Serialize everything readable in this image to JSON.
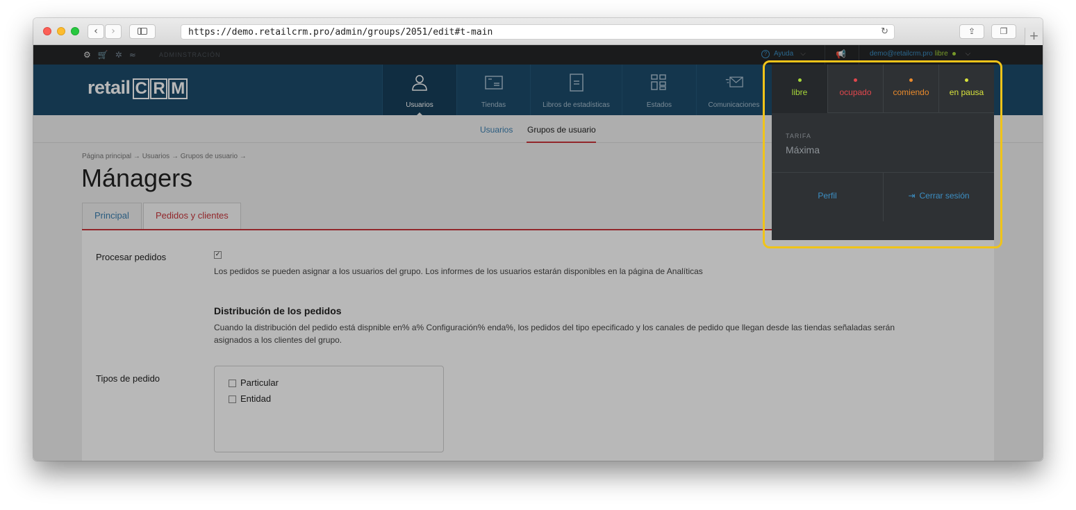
{
  "browser": {
    "url": "https://demo.retailcrm.pro/admin/groups/2051/edit#t-main",
    "back_glyph": "‹",
    "forward_glyph": "›",
    "reload_glyph": "↻",
    "share_glyph": "⇪",
    "tabs_glyph": "❐",
    "newtab_glyph": "+"
  },
  "topbar": {
    "icons": [
      "gear-icon",
      "cart-icon",
      "settings-icon",
      "analytics-icon"
    ],
    "icon_glyphs": [
      "⚙",
      "🛒",
      "✲",
      "≈"
    ],
    "admin_label": "ADMINSTRACIÓN",
    "help_label": "Ayuda",
    "help_icon_glyph": "?",
    "chevron_glyph": "⌵",
    "megaphone_glyph": "📢",
    "user_email": "demo@retailcrm.pro",
    "user_status": "libre"
  },
  "header": {
    "logo_text": "retail",
    "logo_crm": [
      "C",
      "R",
      "M"
    ],
    "nav": [
      {
        "label": "Usuarios",
        "icon": "user-icon",
        "active": true
      },
      {
        "label": "Tiendas",
        "icon": "store-icon",
        "active": false
      },
      {
        "label": "Libros de estadísticas",
        "icon": "book-icon",
        "active": false
      },
      {
        "label": "Estados",
        "icon": "grid-icon",
        "active": false
      },
      {
        "label": "Comunicaciones",
        "icon": "mail-icon",
        "active": false
      }
    ]
  },
  "subnav": {
    "users_label": "Usuarios",
    "groups_label": "Grupos de usuario"
  },
  "page": {
    "breadcrumb": "Página principal → Usuarios → Grupos de usuario →",
    "title": "Mánagers",
    "tabs": [
      "Principal",
      "Pedidos y clientes"
    ]
  },
  "form": {
    "process_label": "Procesar pedidos",
    "process_checked": "✓",
    "process_hint": "Los pedidos se pueden asignar a los usuarios del grupo. Los informes de los usuarios estarán disponibles en la página de Analíticas",
    "distribution_title": "Distribución de los pedidos",
    "distribution_hint_1": "Cuando la distribución del pedido está dispnible en% a% Configuración% enda%, los pedidos del tipo epecificado y los canales de pedido que llegan desde las tiendas señaladas serán",
    "distribution_hint_2": "asignados a los clientes del grupo.",
    "types_label": "Tipos de pedido",
    "types": [
      "Particular",
      "Entidad"
    ]
  },
  "dropdown": {
    "statuses": [
      {
        "label": "libre",
        "color": "#a6d63a"
      },
      {
        "label": "ocupado",
        "color": "#e2474d"
      },
      {
        "label": "comiendo",
        "color": "#e98a2c"
      },
      {
        "label": "en pausa",
        "color": "#d8e23c"
      }
    ],
    "tarifa_label": "TARIFA",
    "tarifa_value": "Máxima",
    "profile_label": "Perfil",
    "logout_label": "Cerrar sesión",
    "logout_glyph": "⇥"
  },
  "colors": {
    "accent": "#c9353b",
    "link": "#3a7fb0",
    "header_bg": "#1c4b6b",
    "highlight": "#f0c419"
  }
}
